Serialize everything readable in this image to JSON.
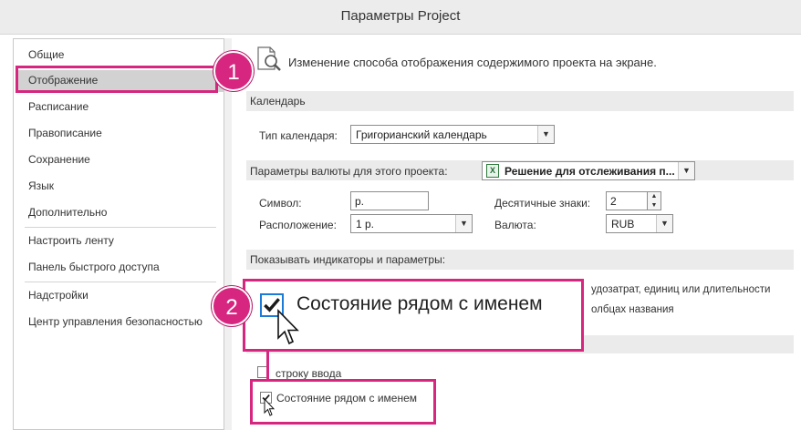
{
  "window": {
    "title": "Параметры Project"
  },
  "sidebar": {
    "items": [
      {
        "label": "Общие"
      },
      {
        "label": "Отображение",
        "selected": true
      },
      {
        "label": "Расписание"
      },
      {
        "label": "Правописание"
      },
      {
        "label": "Сохранение"
      },
      {
        "label": "Язык"
      },
      {
        "label": "Дополнительно"
      },
      {
        "label": "Настроить ленту"
      },
      {
        "label": "Панель быстрого доступа"
      },
      {
        "label": "Надстройки"
      },
      {
        "label": "Центр управления безопасностью"
      }
    ]
  },
  "main": {
    "description": "Изменение способа отображения содержимого проекта на экране.",
    "calendar": {
      "section_title": "Календарь",
      "type_label": "Тип календаря:",
      "type_value": "Григорианский календарь"
    },
    "currency": {
      "section_label": "Параметры валюты для этого проекта:",
      "project_value": "Решение для отслеживания п...",
      "symbol_label": "Символ:",
      "symbol_value": "р.",
      "placement_label": "Расположение:",
      "placement_value": "1 р.",
      "decimals_label": "Десятичные знаки:",
      "decimals_value": "2",
      "currency_label": "Валюта:",
      "currency_value": "RUB"
    },
    "indicators": {
      "section_title": "Показывать индикаторы и параметры:",
      "partial_line_1": "удозатрат, единиц или длительности",
      "partial_line_2": "олбцах названия",
      "formula_bar_label": "строку ввода",
      "formula_bar_checked": false,
      "status_next_to_name_label": "Состояние рядом с именем",
      "status_next_to_name_checked": true
    }
  },
  "callouts": {
    "step1": "1",
    "step2": "2",
    "zoom_label": "Состояние рядом с именем",
    "accent_color": "#d6267f"
  },
  "icons": {
    "description_icon": "magnifier-document-icon",
    "dropdown_icon": "chevron-down-icon",
    "project_icon": "excel-icon",
    "cursor_icon": "mouse-pointer-icon",
    "checkbox_icon": "checkmark-icon"
  }
}
